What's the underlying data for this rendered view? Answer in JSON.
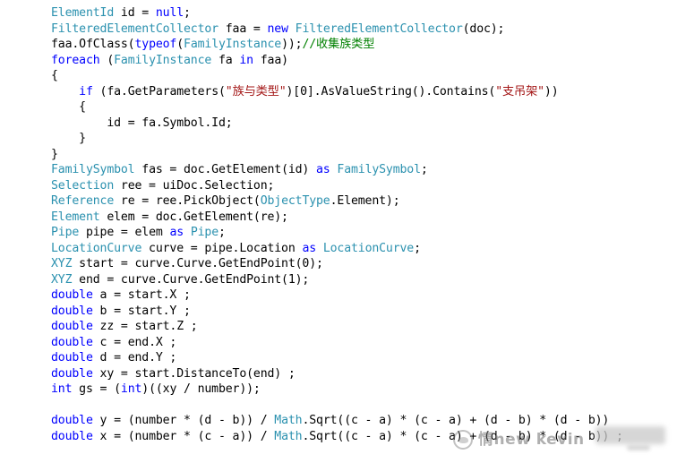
{
  "editor": {
    "language": "csharp",
    "background_color": "#ffffff",
    "default_text_color": "#000000",
    "syntax_colors": {
      "keyword": "#0000ff",
      "type": "#2b91af",
      "string": "#a31515",
      "comment": "#008000",
      "plain": "#000000"
    },
    "lines": [
      {
        "indent": 0,
        "tokens": [
          {
            "t": "type",
            "v": "ElementId"
          },
          {
            "t": "plain",
            "v": " id = "
          },
          {
            "t": "kw",
            "v": "null"
          },
          {
            "t": "plain",
            "v": ";"
          }
        ]
      },
      {
        "indent": 0,
        "tokens": [
          {
            "t": "type",
            "v": "FilteredElementCollector"
          },
          {
            "t": "plain",
            "v": " faa = "
          },
          {
            "t": "kw",
            "v": "new"
          },
          {
            "t": "plain",
            "v": " "
          },
          {
            "t": "type",
            "v": "FilteredElementCollector"
          },
          {
            "t": "plain",
            "v": "(doc);"
          }
        ]
      },
      {
        "indent": 0,
        "tokens": [
          {
            "t": "plain",
            "v": "faa.OfClass("
          },
          {
            "t": "kw",
            "v": "typeof"
          },
          {
            "t": "plain",
            "v": "("
          },
          {
            "t": "type",
            "v": "FamilyInstance"
          },
          {
            "t": "plain",
            "v": "));"
          },
          {
            "t": "comment",
            "v": "//收集族类型"
          }
        ]
      },
      {
        "indent": 0,
        "tokens": [
          {
            "t": "kw",
            "v": "foreach"
          },
          {
            "t": "plain",
            "v": " ("
          },
          {
            "t": "type",
            "v": "FamilyInstance"
          },
          {
            "t": "plain",
            "v": " fa "
          },
          {
            "t": "kw",
            "v": "in"
          },
          {
            "t": "plain",
            "v": " faa)"
          }
        ]
      },
      {
        "indent": 0,
        "tokens": [
          {
            "t": "plain",
            "v": "{"
          }
        ]
      },
      {
        "indent": 1,
        "tokens": [
          {
            "t": "kw",
            "v": "if"
          },
          {
            "t": "plain",
            "v": " (fa.GetParameters("
          },
          {
            "t": "str",
            "v": "\"族与类型\""
          },
          {
            "t": "plain",
            "v": ")[0].AsValueString().Contains("
          },
          {
            "t": "str",
            "v": "\"支吊架\""
          },
          {
            "t": "plain",
            "v": "))"
          }
        ]
      },
      {
        "indent": 1,
        "tokens": [
          {
            "t": "plain",
            "v": "{"
          }
        ]
      },
      {
        "indent": 2,
        "tokens": [
          {
            "t": "plain",
            "v": "id = fa.Symbol.Id;"
          }
        ]
      },
      {
        "indent": 1,
        "tokens": [
          {
            "t": "plain",
            "v": "}"
          }
        ]
      },
      {
        "indent": 0,
        "tokens": [
          {
            "t": "plain",
            "v": "}"
          }
        ]
      },
      {
        "indent": 0,
        "tokens": [
          {
            "t": "type",
            "v": "FamilySymbol"
          },
          {
            "t": "plain",
            "v": " fas = doc.GetElement(id) "
          },
          {
            "t": "kw",
            "v": "as"
          },
          {
            "t": "plain",
            "v": " "
          },
          {
            "t": "type",
            "v": "FamilySymbol"
          },
          {
            "t": "plain",
            "v": ";"
          }
        ]
      },
      {
        "indent": 0,
        "tokens": [
          {
            "t": "type",
            "v": "Selection"
          },
          {
            "t": "plain",
            "v": " ree = uiDoc.Selection;"
          }
        ]
      },
      {
        "indent": 0,
        "tokens": [
          {
            "t": "type",
            "v": "Reference"
          },
          {
            "t": "plain",
            "v": " re = ree.PickObject("
          },
          {
            "t": "type",
            "v": "ObjectType"
          },
          {
            "t": "plain",
            "v": ".Element);"
          }
        ]
      },
      {
        "indent": 0,
        "tokens": [
          {
            "t": "type",
            "v": "Element"
          },
          {
            "t": "plain",
            "v": " elem = doc.GetElement(re);"
          }
        ]
      },
      {
        "indent": 0,
        "tokens": [
          {
            "t": "type",
            "v": "Pipe"
          },
          {
            "t": "plain",
            "v": " pipe = elem "
          },
          {
            "t": "kw",
            "v": "as"
          },
          {
            "t": "plain",
            "v": " "
          },
          {
            "t": "type",
            "v": "Pipe"
          },
          {
            "t": "plain",
            "v": ";"
          }
        ]
      },
      {
        "indent": 0,
        "tokens": [
          {
            "t": "type",
            "v": "LocationCurve"
          },
          {
            "t": "plain",
            "v": " curve = pipe.Location "
          },
          {
            "t": "kw",
            "v": "as"
          },
          {
            "t": "plain",
            "v": " "
          },
          {
            "t": "type",
            "v": "LocationCurve"
          },
          {
            "t": "plain",
            "v": ";"
          }
        ]
      },
      {
        "indent": 0,
        "tokens": [
          {
            "t": "type",
            "v": "XYZ"
          },
          {
            "t": "plain",
            "v": " start = curve.Curve.GetEndPoint(0);"
          }
        ]
      },
      {
        "indent": 0,
        "tokens": [
          {
            "t": "type",
            "v": "XYZ"
          },
          {
            "t": "plain",
            "v": " end = curve.Curve.GetEndPoint(1);"
          }
        ]
      },
      {
        "indent": 0,
        "tokens": [
          {
            "t": "kw",
            "v": "double"
          },
          {
            "t": "plain",
            "v": " a = start.X ;"
          }
        ]
      },
      {
        "indent": 0,
        "tokens": [
          {
            "t": "kw",
            "v": "double"
          },
          {
            "t": "plain",
            "v": " b = start.Y ;"
          }
        ]
      },
      {
        "indent": 0,
        "tokens": [
          {
            "t": "kw",
            "v": "double"
          },
          {
            "t": "plain",
            "v": " zz = start.Z ;"
          }
        ]
      },
      {
        "indent": 0,
        "tokens": [
          {
            "t": "kw",
            "v": "double"
          },
          {
            "t": "plain",
            "v": " c = end.X ;"
          }
        ]
      },
      {
        "indent": 0,
        "tokens": [
          {
            "t": "kw",
            "v": "double"
          },
          {
            "t": "plain",
            "v": " d = end.Y ;"
          }
        ]
      },
      {
        "indent": 0,
        "tokens": [
          {
            "t": "kw",
            "v": "double"
          },
          {
            "t": "plain",
            "v": " xy = start.DistanceTo(end) ;"
          }
        ]
      },
      {
        "indent": 0,
        "tokens": [
          {
            "t": "kw",
            "v": "int"
          },
          {
            "t": "plain",
            "v": " gs = ("
          },
          {
            "t": "kw",
            "v": "int"
          },
          {
            "t": "plain",
            "v": ")((xy / number));"
          }
        ]
      },
      {
        "indent": 0,
        "tokens": []
      },
      {
        "indent": 0,
        "tokens": [
          {
            "t": "kw",
            "v": "double"
          },
          {
            "t": "plain",
            "v": " y = (number * (d - b)) / "
          },
          {
            "t": "type",
            "v": "Math"
          },
          {
            "t": "plain",
            "v": ".Sqrt((c - a) * (c - a) + (d - b) * (d - b))"
          }
        ]
      },
      {
        "indent": 0,
        "tokens": [
          {
            "t": "kw",
            "v": "double"
          },
          {
            "t": "plain",
            "v": " x = (number * (c - a)) / "
          },
          {
            "t": "type",
            "v": "Math"
          },
          {
            "t": "plain",
            "v": ".Sqrt((c - a) * (c - a) + (d - b) * (d - b)) ;"
          }
        ]
      }
    ]
  },
  "watermark": {
    "text": "情new kevin",
    "logo_icon": "wechat-logo-icon",
    "opacity_note": "semi-transparent grey overlay"
  }
}
